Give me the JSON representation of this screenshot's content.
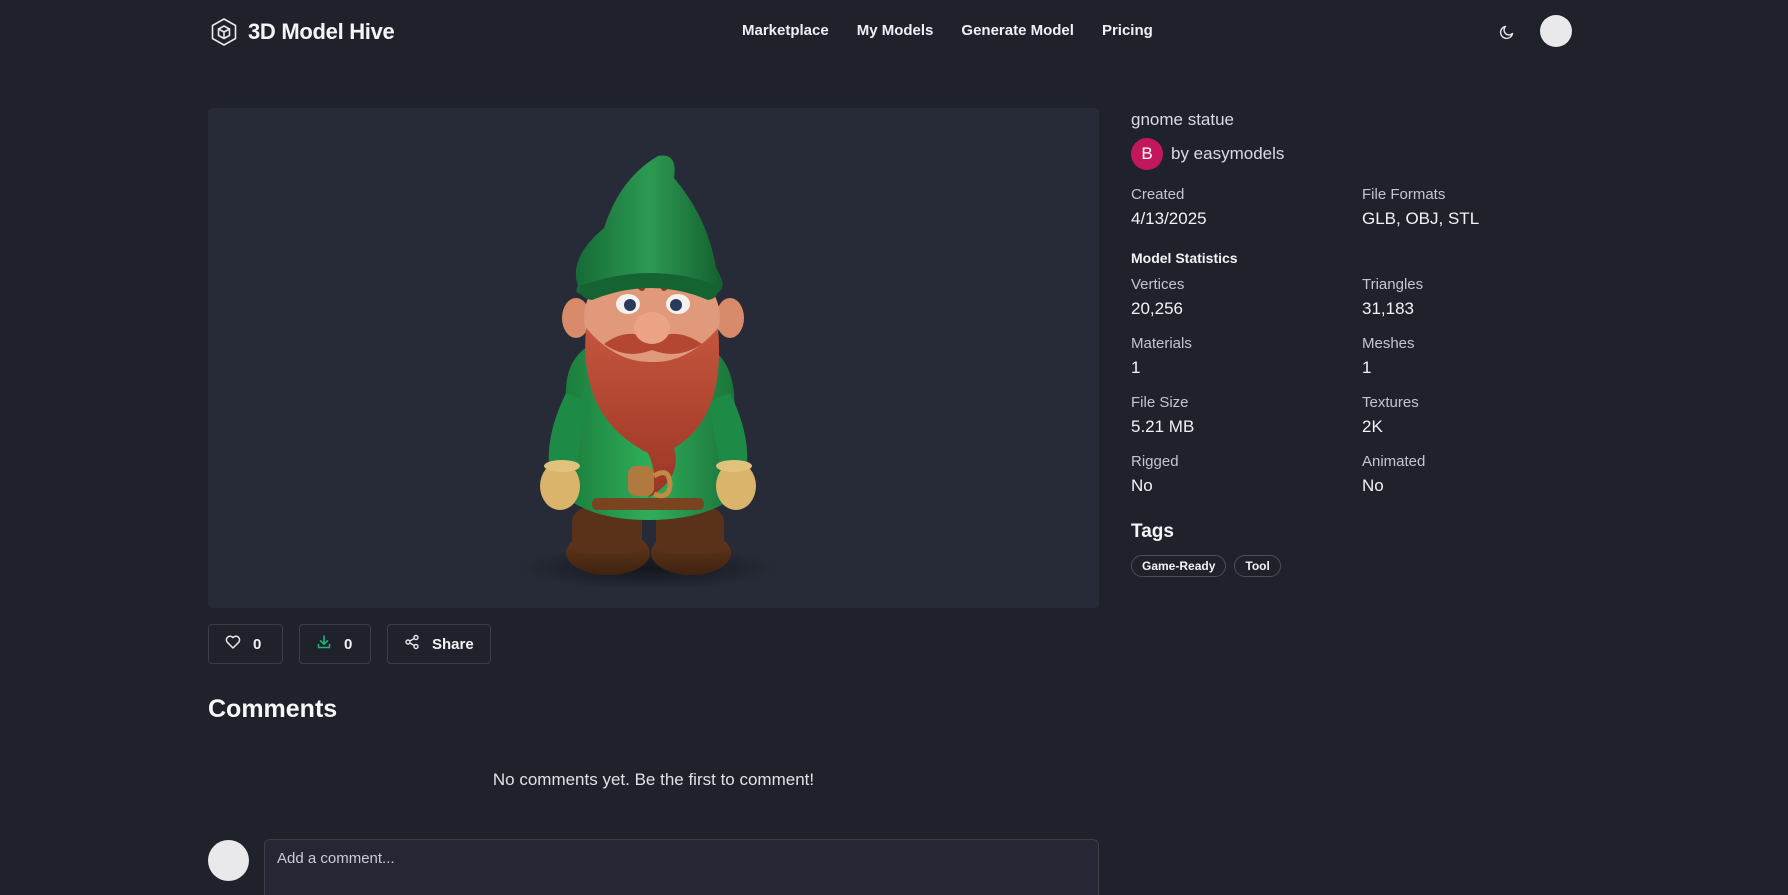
{
  "header": {
    "brand": "3D Model Hive",
    "nav": [
      "Marketplace",
      "My Models",
      "Generate Model",
      "Pricing"
    ]
  },
  "model": {
    "title": "gnome statue",
    "author_initial": "B",
    "author": "by easymodels",
    "created_label": "Created",
    "created_value": "4/13/2025",
    "formats_label": "File Formats",
    "formats_value": "GLB, OBJ, STL"
  },
  "statistics": {
    "heading": "Model Statistics",
    "items": [
      {
        "label": "Vertices",
        "value": "20,256"
      },
      {
        "label": "Triangles",
        "value": "31,183"
      },
      {
        "label": "Materials",
        "value": "1"
      },
      {
        "label": "Meshes",
        "value": "1"
      },
      {
        "label": "File Size",
        "value": "5.21 MB"
      },
      {
        "label": "Textures",
        "value": "2K"
      },
      {
        "label": "Rigged",
        "value": "No"
      },
      {
        "label": "Animated",
        "value": "No"
      }
    ]
  },
  "tags": {
    "title": "Tags",
    "items": [
      "Game-Ready",
      "Tool"
    ]
  },
  "actions": {
    "likes": "0",
    "downloads": "0",
    "share": "Share"
  },
  "comments": {
    "title": "Comments",
    "empty": "No comments yet. Be the first to comment!",
    "placeholder": "Add a comment..."
  },
  "colors": {
    "background": "#1f222b",
    "viewer": "#272b37",
    "author_avatar": "#c2185b",
    "download_icon": "#21b37a"
  },
  "icons": {
    "logo": "cube-icon",
    "theme": "moon-icon",
    "like": "heart-icon",
    "download": "download-icon",
    "share": "share-icon"
  }
}
